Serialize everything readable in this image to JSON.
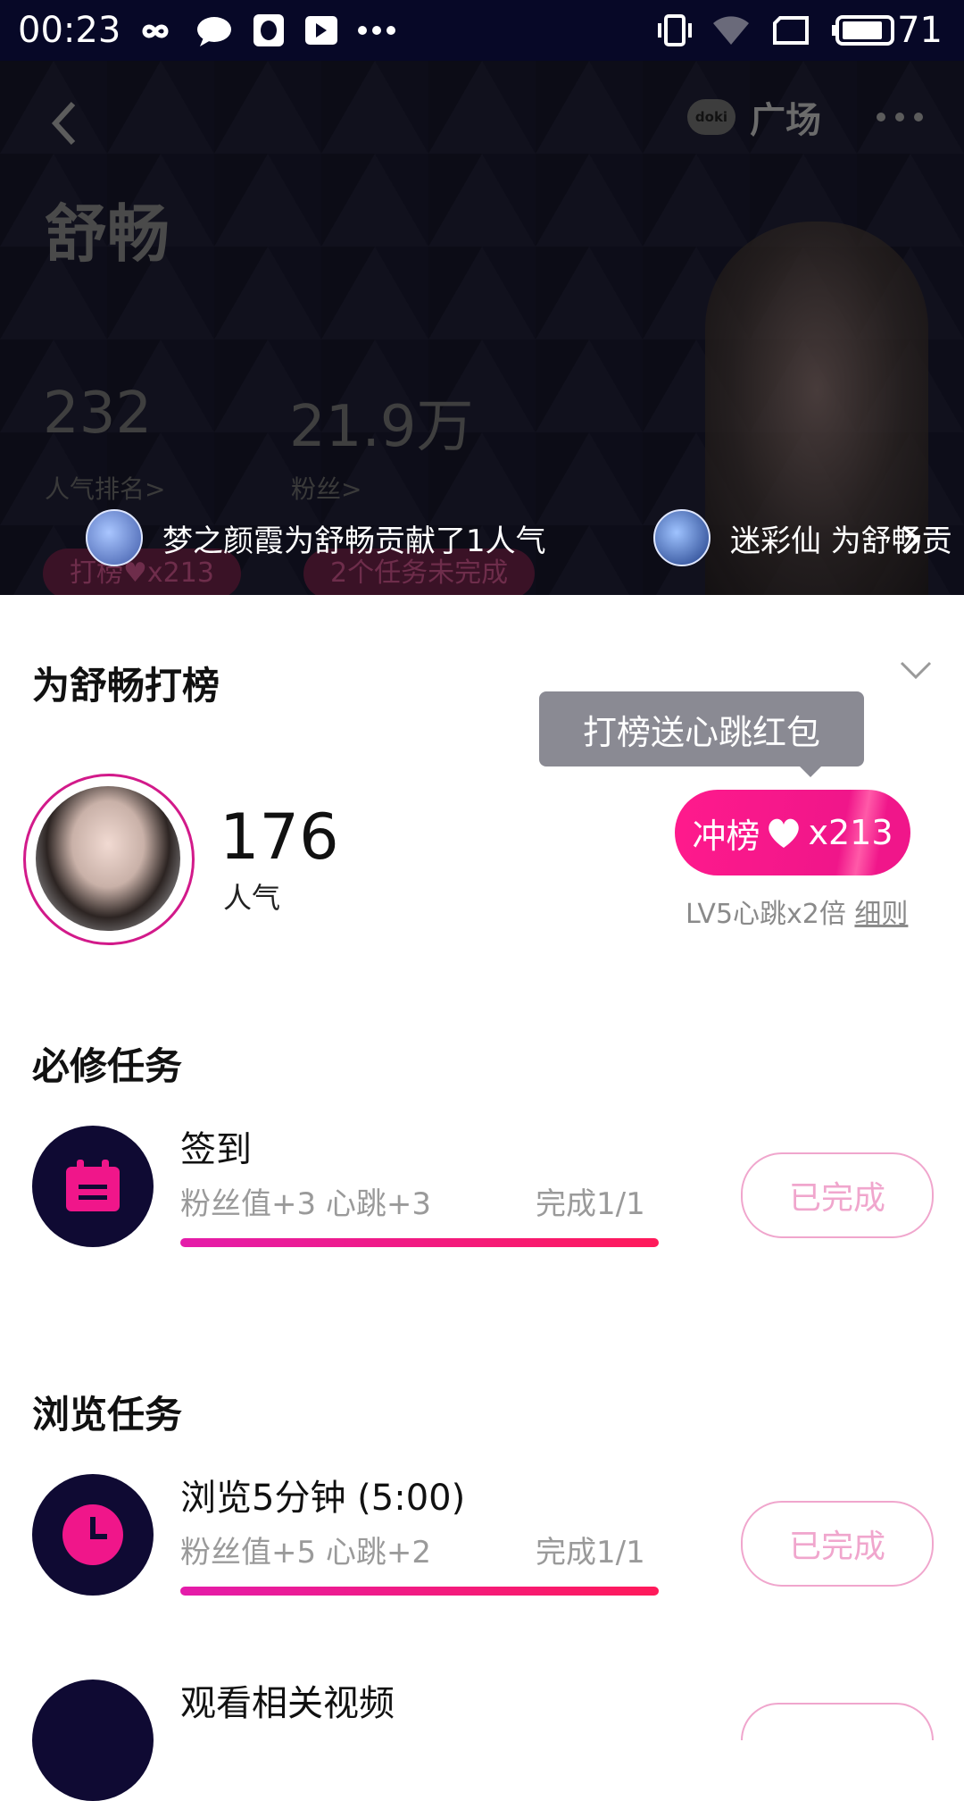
{
  "status_bar": {
    "time": "00:23",
    "battery": "71"
  },
  "header": {
    "plaza_label": "广场",
    "doki_logo_text": "doki",
    "star_name": "舒畅",
    "rank_value": "232",
    "rank_label": "人气排名>",
    "fans_value": "21.9万",
    "fans_label": "粉丝>",
    "ticker": [
      {
        "text": "梦之颜霞为舒畅贡献了1人气"
      },
      {
        "text": "迷彩仙 为舒畅贡"
      }
    ],
    "pill_rank": "打榜",
    "pill_rank_count": "x213",
    "pill_tasks": "2个任务未完成"
  },
  "rank_section": {
    "title": "为舒畅打榜",
    "tooltip": "打榜送心跳红包",
    "popularity_value": "176",
    "popularity_label": "人气",
    "rank_button_label": "冲榜",
    "rank_button_count": "x213",
    "level_text": "LV5心跳x2倍",
    "rules_link": "细则"
  },
  "required_tasks": {
    "title": "必修任务",
    "items": [
      {
        "name": "签到",
        "reward": "粉丝值+3 心跳+3",
        "progress_text": "完成1/1",
        "progress": 1.0,
        "button": "已完成",
        "icon": "calendar-icon"
      }
    ]
  },
  "browse_tasks": {
    "title": "浏览任务",
    "items": [
      {
        "name": "浏览5分钟 (5:00)",
        "reward": "粉丝值+5 心跳+2",
        "progress_text": "完成1/1",
        "progress": 1.0,
        "button": "已完成",
        "icon": "clock-icon"
      },
      {
        "name": "观看相关视频",
        "icon": "video-icon"
      }
    ]
  },
  "colors": {
    "accent": "#f0168a",
    "dark_bg": "#0c0c16",
    "status_bar": "#070827",
    "task_icon_bg": "#0f0a33"
  }
}
